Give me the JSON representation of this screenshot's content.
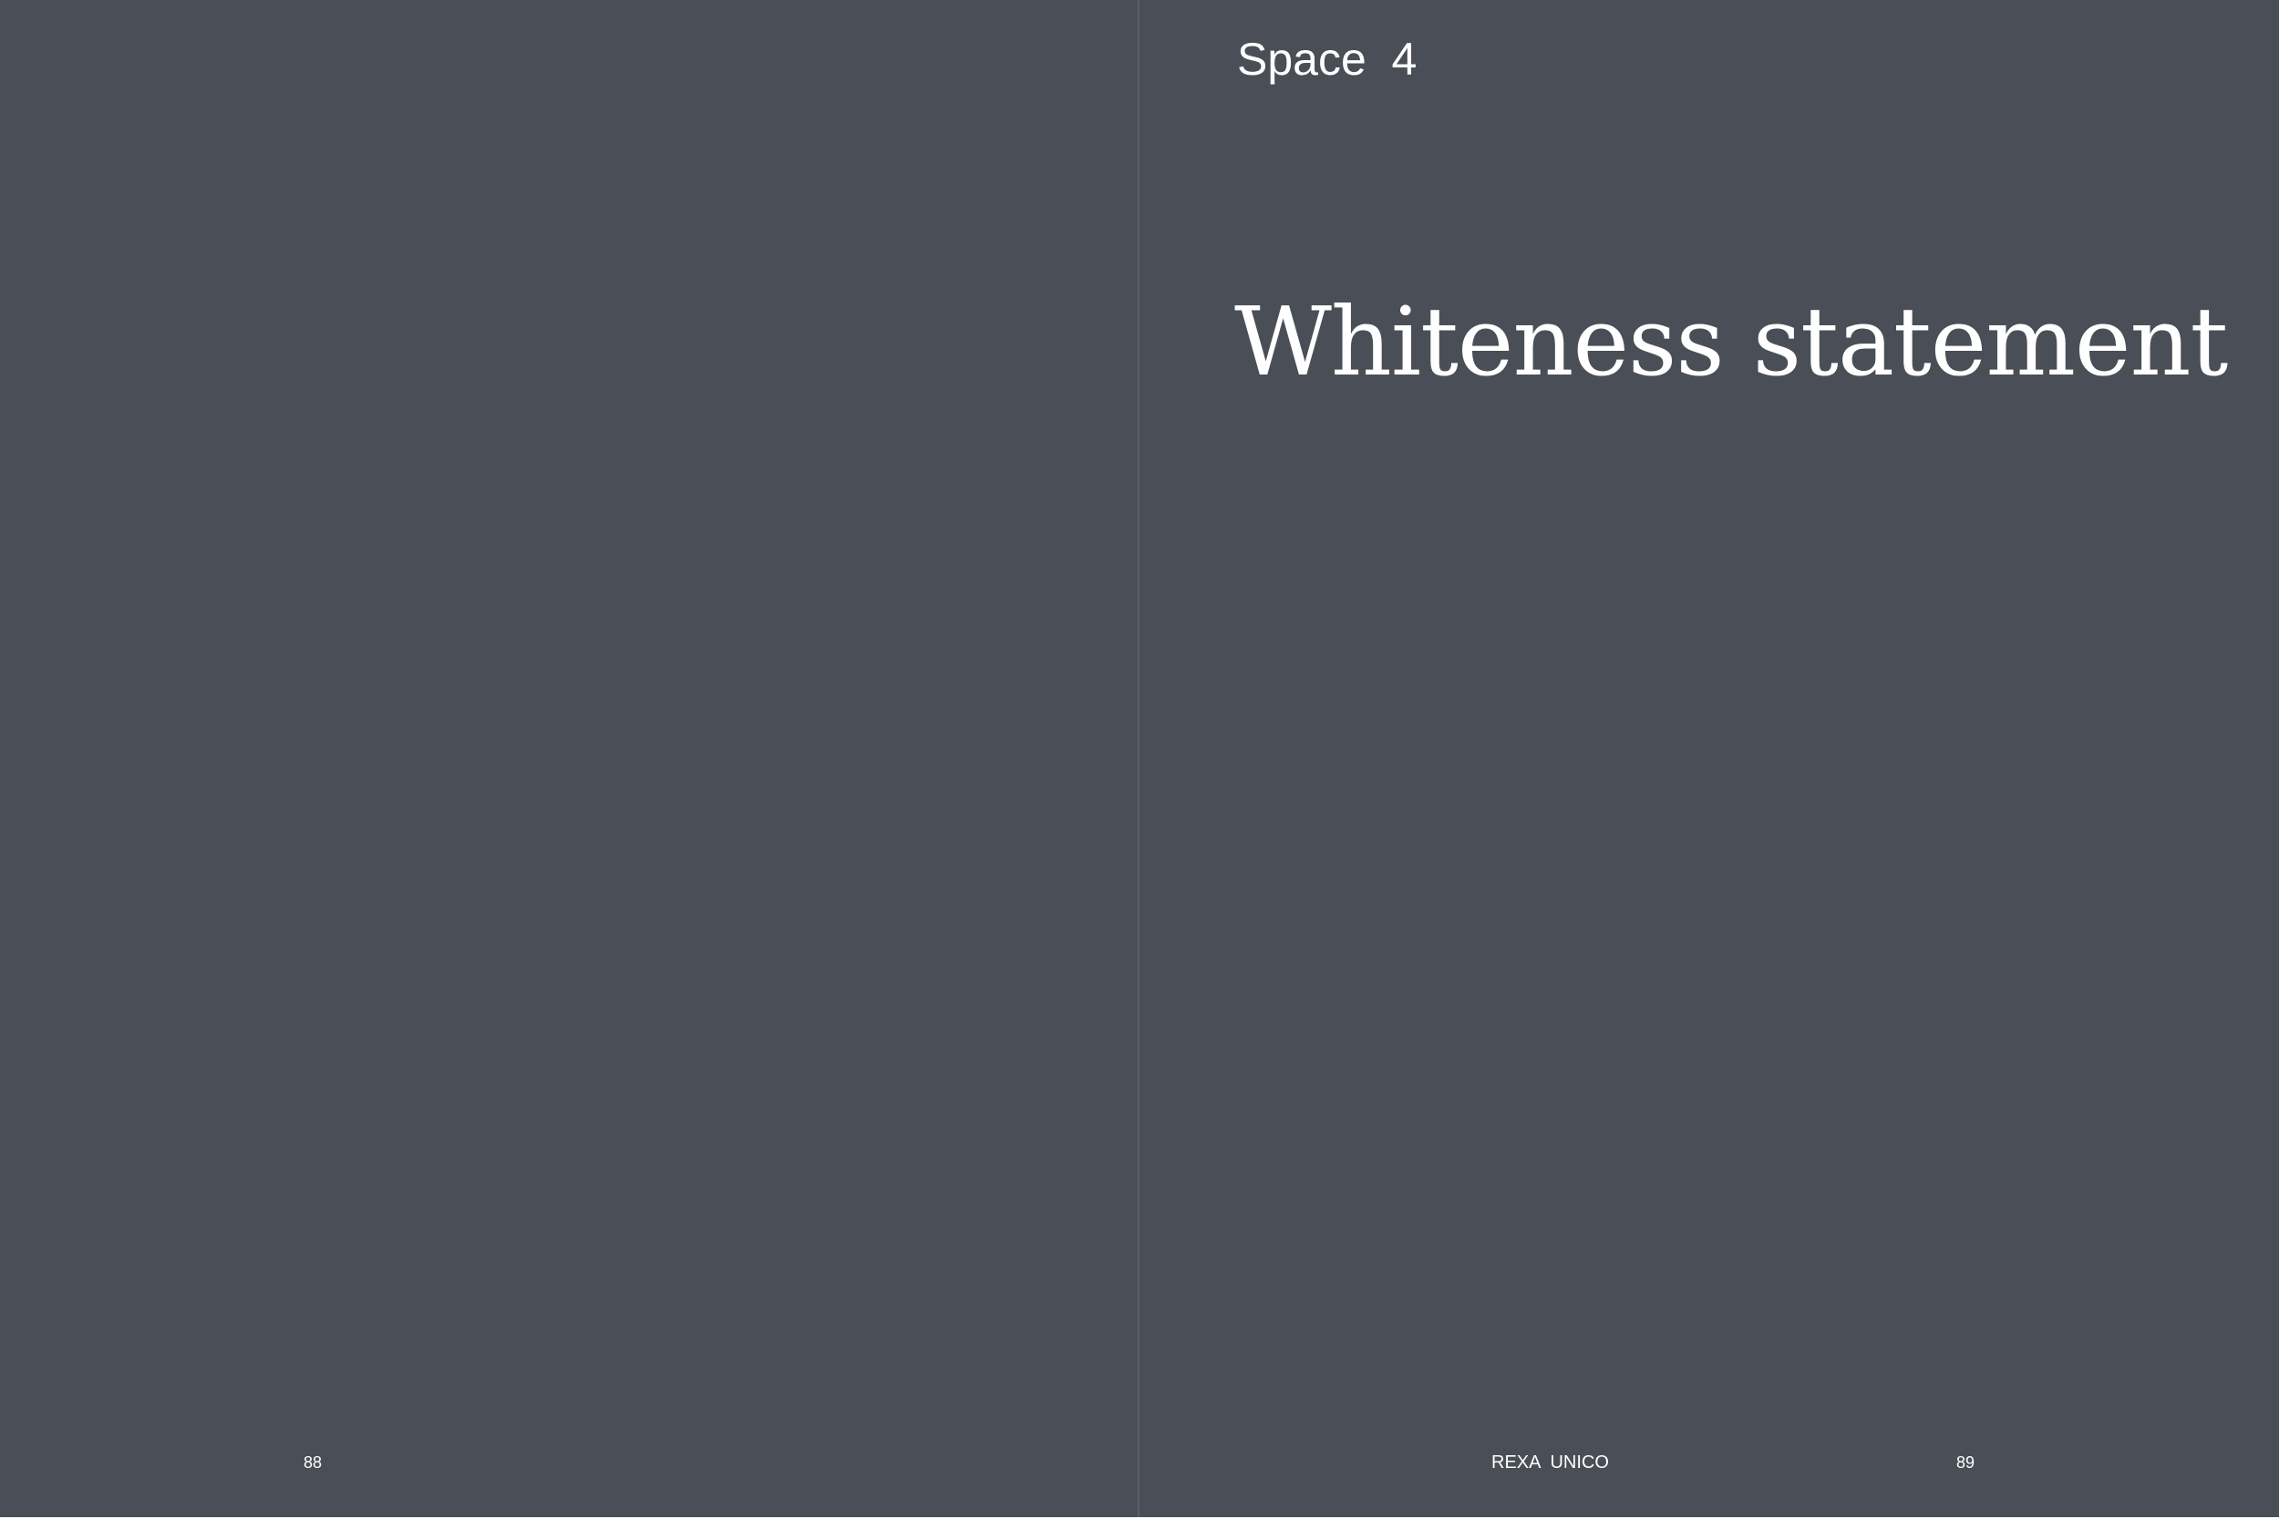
{
  "left_page": {
    "page_number": "88"
  },
  "right_page": {
    "section_label": "Space  4",
    "title": "Whiteness statement",
    "running_footer": "REXA  UNICO",
    "page_number": "89"
  },
  "colors": {
    "background": "#4a4f57",
    "text": "#ffffff",
    "gutter": "#5a5f67"
  }
}
